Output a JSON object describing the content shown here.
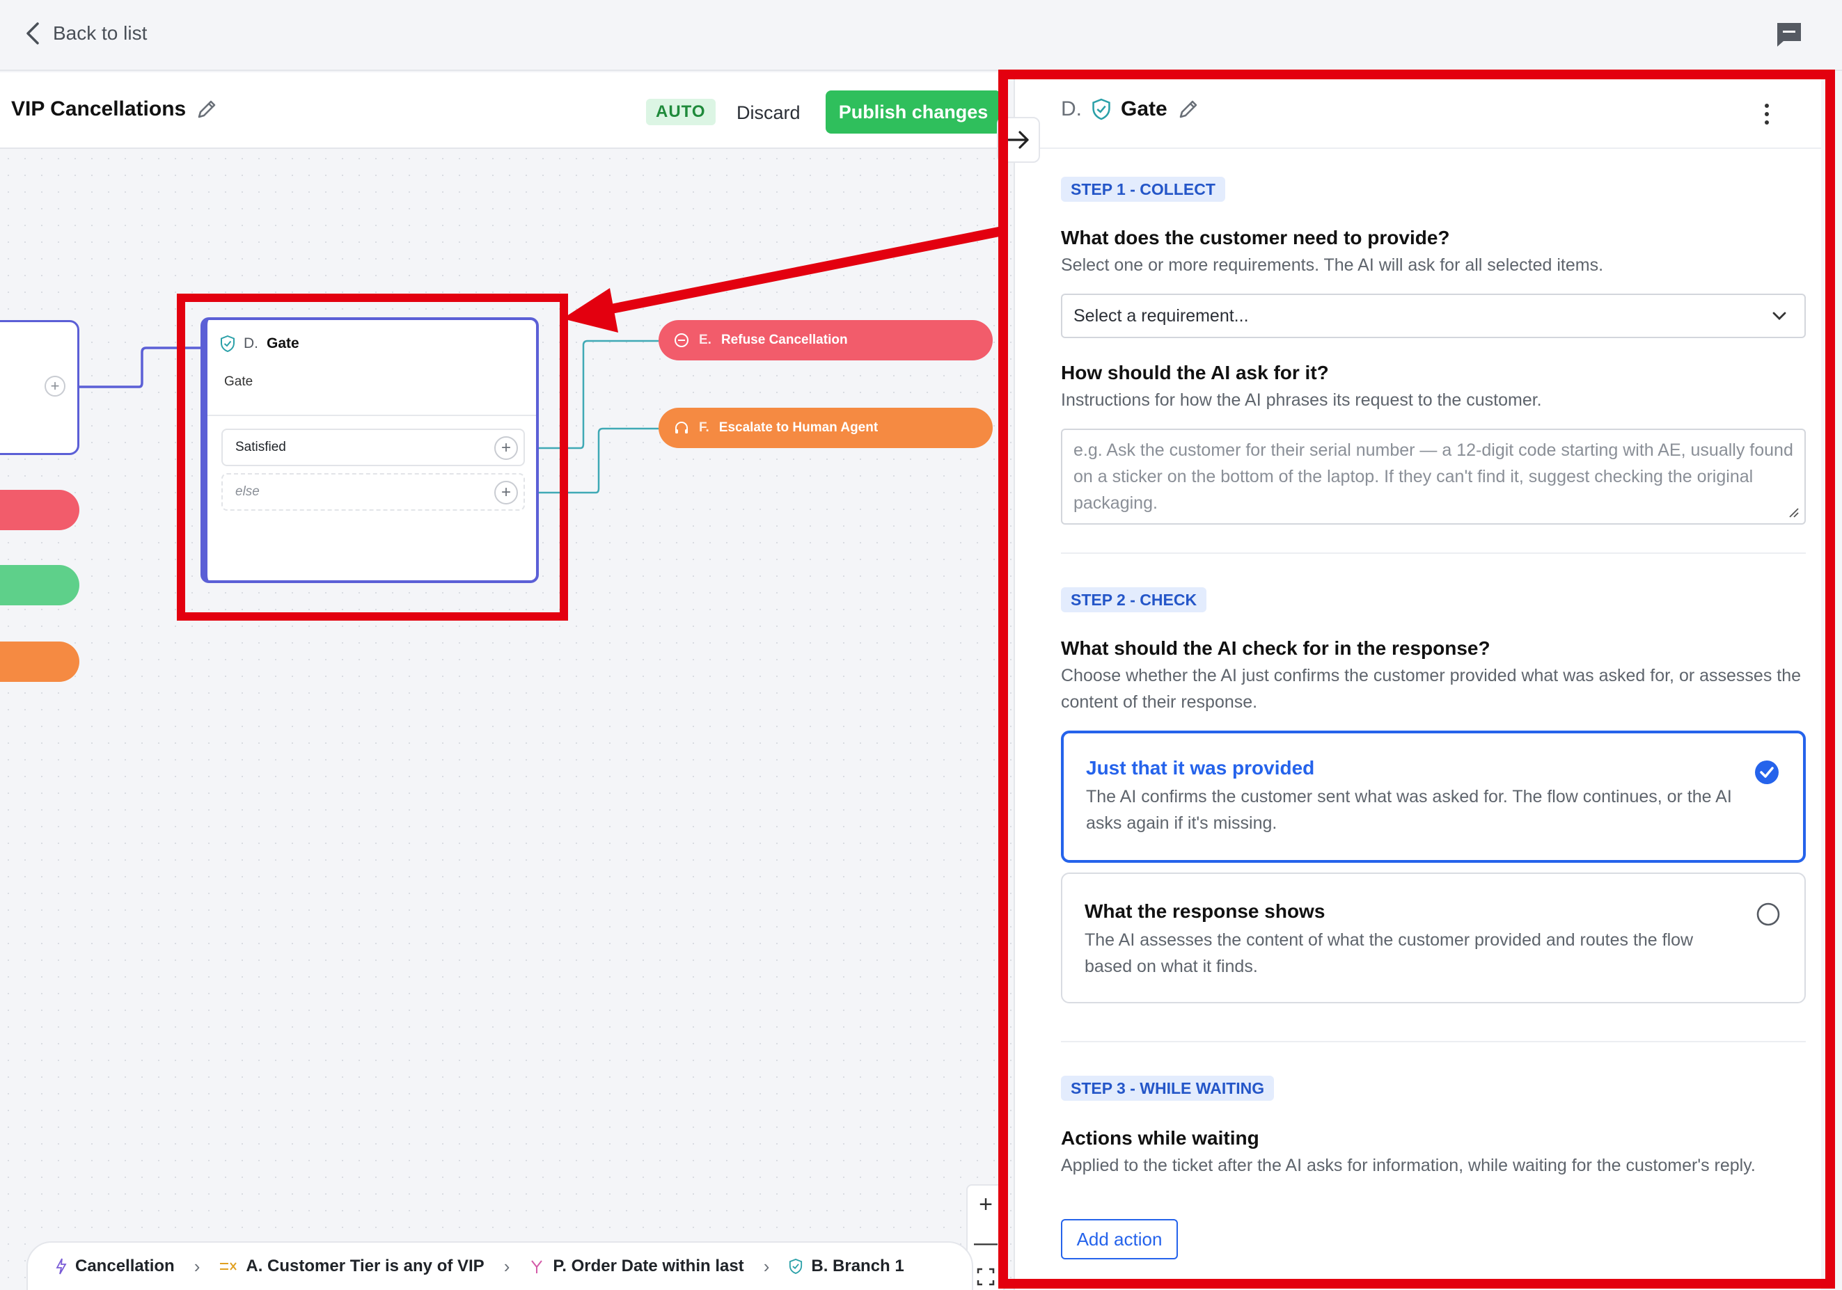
{
  "topbar": {
    "back_label": "Back to list"
  },
  "flow": {
    "title": "VIP Cancellations",
    "mode_badge": "AUTO",
    "discard_label": "Discard",
    "publish_label": "Publish changes"
  },
  "canvas": {
    "gate_node": {
      "letter": "D.",
      "name": "Gate",
      "subtitle": "Gate",
      "conditions": [
        {
          "label": "Satisfied"
        },
        {
          "label": "else"
        }
      ]
    },
    "action_nodes": [
      {
        "letter": "E.",
        "label": "Refuse Cancellation",
        "color": "#f25c6b"
      },
      {
        "letter": "F.",
        "label": "Escalate to Human Agent",
        "color": "#f58a42"
      }
    ]
  },
  "breadcrumbs": [
    {
      "label": "Cancellation",
      "icon": "trigger-icon"
    },
    {
      "label": "A. Customer Tier is any of VIP",
      "icon": "condition-icon"
    },
    {
      "label": "P. Order Date within last",
      "icon": "branch-icon"
    },
    {
      "label": "B. Branch 1",
      "icon": "gate-shield-icon"
    }
  ],
  "zoom": {
    "in": "+",
    "out": "—"
  },
  "panel": {
    "letter": "D.",
    "name": "Gate",
    "step1": {
      "badge": "STEP 1 - COLLECT",
      "question": "What does the customer need to provide?",
      "description": "Select one or more requirements. The AI will ask for all selected items.",
      "select_placeholder": "Select a requirement...",
      "how_question": "How should the AI ask for it?",
      "how_description": "Instructions for how the AI phrases its request to the customer.",
      "textarea_placeholder": "e.g. Ask the customer for their serial number — a 12-digit code starting with AE, usually found on a sticker on the bottom of the laptop. If they can't find it, suggest checking the original packaging."
    },
    "step2": {
      "badge": "STEP 2 - CHECK",
      "question": "What should the AI check for in the response?",
      "description": "Choose whether the AI just confirms the customer provided what was asked for, or assesses the content of their response.",
      "options": [
        {
          "title": "Just that it was provided",
          "description": "The AI confirms the customer sent what was asked for. The flow continues, or the AI asks again if it's missing.",
          "selected": true
        },
        {
          "title": "What the response shows",
          "description": "The AI assesses the content of what the customer provided and routes the flow based on what it finds.",
          "selected": false
        }
      ]
    },
    "step3": {
      "badge": "STEP 3 - WHILE WAITING",
      "question": "Actions while waiting",
      "description": "Applied to the ticket after the AI asks for information, while waiting for the customer's reply.",
      "add_action_label": "Add action"
    }
  },
  "colors": {
    "accent_blue": "#2563eb",
    "publish_green": "#2fbf5c",
    "node_purple": "#5b5fd6",
    "highlight_red": "#e3000f"
  }
}
